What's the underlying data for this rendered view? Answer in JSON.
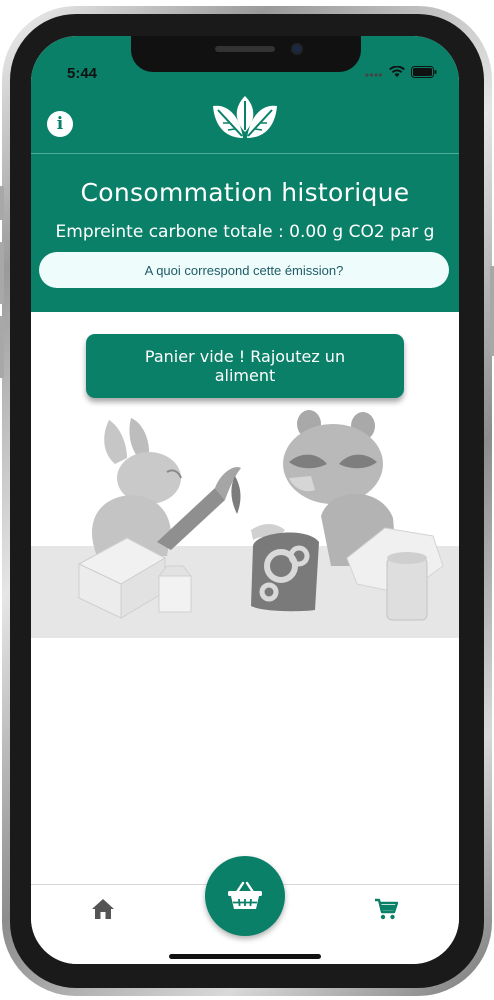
{
  "status_bar": {
    "time": "5:44"
  },
  "header": {
    "info_icon": "info-icon",
    "logo_icon": "leaf-logo-icon"
  },
  "summary": {
    "title": "Consommation historique",
    "footprint_text": "Empreinte carbone totale : 0.00 g CO2 par g",
    "info_link": "A quoi correspond cette émission?"
  },
  "main": {
    "empty_basket_button": "Panier vide ! Rajoutez un aliment",
    "illustration": "rabbit-and-raccoon-illustration"
  },
  "bottom_nav": {
    "home_icon": "home-icon",
    "basket_icon": "basket-icon",
    "cart_icon": "cart-icon"
  },
  "colors": {
    "brand_green": "#0a8068",
    "link_bg": "#eefcfc",
    "illustration_gray": "#c8c8c8"
  }
}
